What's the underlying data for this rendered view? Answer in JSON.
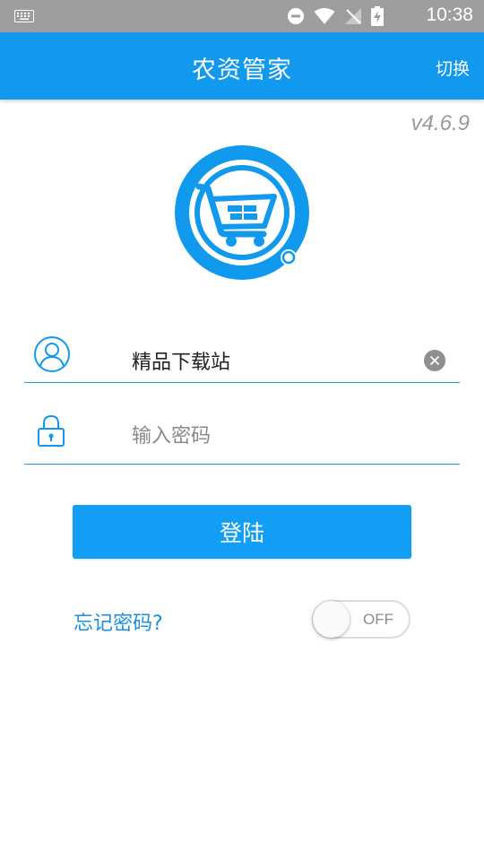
{
  "status_bar": {
    "time": "10:38",
    "icons": [
      "keyboard-icon",
      "dnd-icon",
      "wifi-icon",
      "no-signal-icon",
      "battery-charging-icon"
    ]
  },
  "app_bar": {
    "title": "农资管家",
    "switch_label": "切换"
  },
  "version": "v4.6.9",
  "login": {
    "username_value": "精品下载站",
    "password_placeholder": "输入密码",
    "login_button": "登陆",
    "forgot_label": "忘记密码?",
    "toggle_label": "OFF"
  },
  "colors": {
    "primary": "#1199ee",
    "status_bar": "#9e9e9e",
    "underline": "#1a9be8"
  }
}
